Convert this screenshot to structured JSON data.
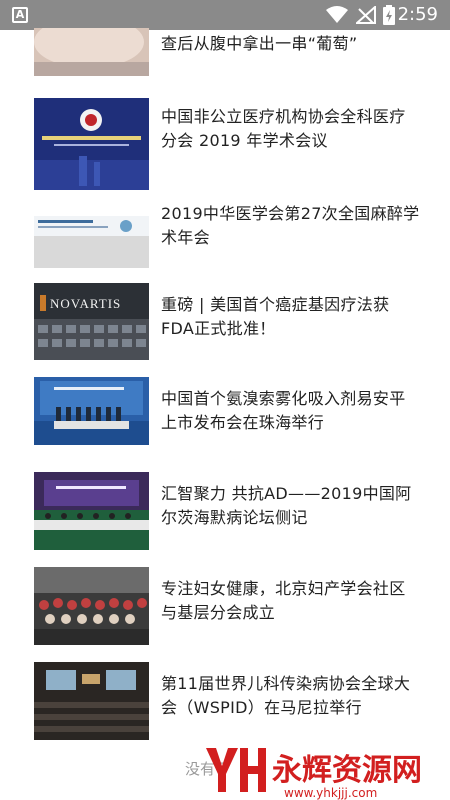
{
  "status_bar": {
    "time": "2:59",
    "app_icon_letter": "A"
  },
  "articles": [
    {
      "title": "查后从腹中拿出一串“葡萄”",
      "thumb_icon": "pregnant-belly-photo"
    },
    {
      "title": "中国非公立医疗机构协会全科医疗分会 2019 年学术会议",
      "thumb_icon": "conference-banner-photo"
    },
    {
      "title": "2019中华医学会第27次全国麻醉学术年会",
      "thumb_icon": "congress-banner-photo"
    },
    {
      "title": "重磅 | 美国首个癌症基因疗法获FDA正式批准！",
      "thumb_icon": "novartis-building-photo",
      "thumb_text": "NOVARTIS"
    },
    {
      "title": "中国首个氨溴索雾化吸入剂易安平上市发布会在珠海举行",
      "thumb_icon": "launch-event-photo"
    },
    {
      "title": "汇智聚力 共抗AD——2019中国阿尔茨海默病论坛侧记",
      "thumb_icon": "forum-stage-photo"
    },
    {
      "title": "专注妇女健康，北京妇产学会社区与基层分会成立",
      "thumb_icon": "group-photo"
    },
    {
      "title": "第11届世界儿科传染病协会全球大会（WSPID）在马尼拉举行",
      "thumb_icon": "conference-hall-photo"
    }
  ],
  "footer": {
    "text": "没有了"
  },
  "watermark": {
    "brand": "永辉资源网",
    "url": "www.yhkjjj.com"
  }
}
